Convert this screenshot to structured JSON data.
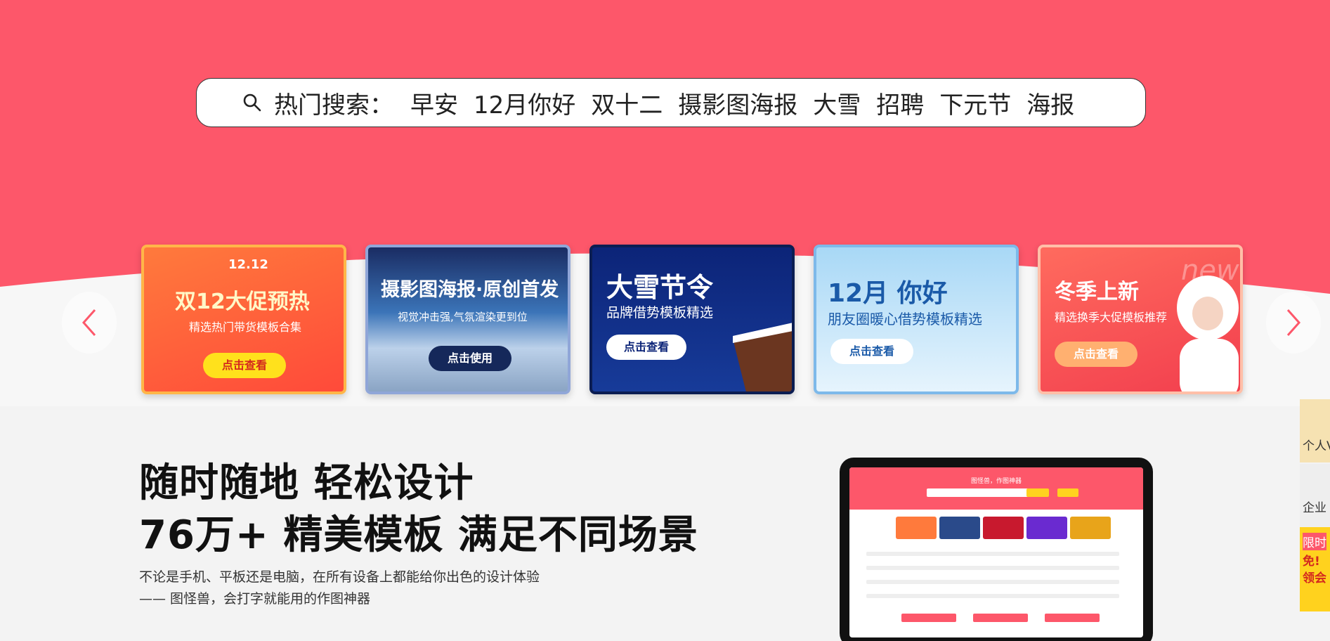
{
  "search": {
    "label": "热门搜索：",
    "keywords": [
      "早安",
      "12月你好",
      "双十二",
      "摄影图海报",
      "大雪",
      "招聘",
      "下元节",
      "海报"
    ]
  },
  "banners": [
    {
      "title": "双12大促预热",
      "subtitle": "精选热门带货模板合集",
      "button": "点击查看",
      "badge": "12.12"
    },
    {
      "title": "摄影图海报·原创首发",
      "subtitle": "视觉冲击强,气氛渲染更到位",
      "button": "点击使用"
    },
    {
      "title": "大雪节令",
      "subtitle": "品牌借势模板精选",
      "button": "点击查看"
    },
    {
      "title": "12月 你好",
      "subtitle": "朋友圈暖心借势模板精选",
      "button": "点击查看"
    },
    {
      "title": "冬季上新",
      "subtitle": "精选换季大促模板推荐",
      "button": "点击查看",
      "badge": "new"
    }
  ],
  "promo": {
    "line1": "随时随地 轻松设计",
    "line2": "76万+ 精美模板 满足不同场景",
    "desc1": "不论是手机、平板还是电脑，在所有设备上都能给你出色的设计体验",
    "desc2": "—— 图怪兽，会打字就能用的作图神器"
  },
  "laptop_screen": {
    "title": "图怪兽，作图神器"
  },
  "side": {
    "tab1": "个人V",
    "tab2": "企业",
    "tab3a": "限时",
    "tab3b": "免!",
    "tab3c": "领会"
  },
  "colors": {
    "brand": "#fd576a",
    "accent": "#ffd21e"
  }
}
